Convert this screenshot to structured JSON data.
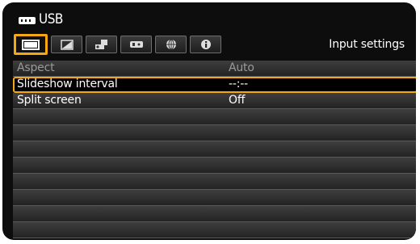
{
  "title": {
    "icon": "usb-icon",
    "text": "USB"
  },
  "tabs": [
    {
      "name": "tab-picture",
      "icon": "screen-icon",
      "active": true
    },
    {
      "name": "tab-image-adjust",
      "icon": "image-adjust-icon",
      "active": false
    },
    {
      "name": "tab-install",
      "icon": "projector-install-icon",
      "active": false
    },
    {
      "name": "tab-system",
      "icon": "system-settings-icon",
      "active": false
    },
    {
      "name": "tab-network",
      "icon": "network-globe-icon",
      "active": false
    },
    {
      "name": "tab-info",
      "icon": "info-icon",
      "active": false
    }
  ],
  "tab_caption": "Input settings",
  "menu": {
    "rows": [
      {
        "label": "Aspect",
        "value": "Auto"
      },
      {
        "label": "Slideshow interval",
        "value": "--:--"
      },
      {
        "label": "Split screen",
        "value": "Off"
      },
      {
        "label": "",
        "value": ""
      },
      {
        "label": "",
        "value": ""
      },
      {
        "label": "",
        "value": ""
      },
      {
        "label": "",
        "value": ""
      },
      {
        "label": "",
        "value": ""
      },
      {
        "label": "",
        "value": ""
      },
      {
        "label": "",
        "value": ""
      },
      {
        "label": "",
        "value": ""
      }
    ]
  },
  "colors": {
    "accent": "#f5a814",
    "background": "#0d0d0d"
  }
}
